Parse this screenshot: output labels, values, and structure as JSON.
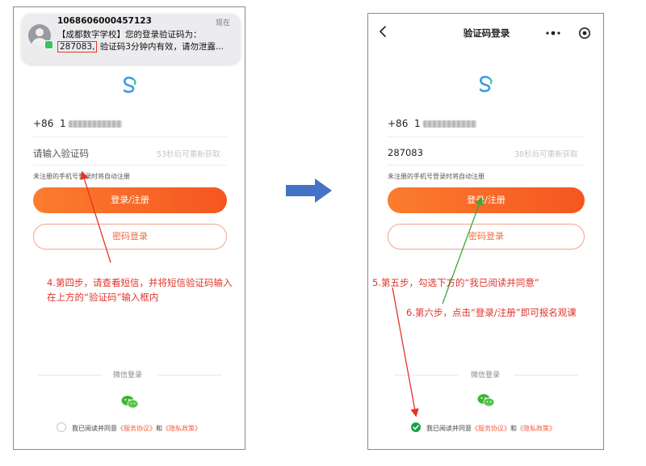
{
  "left": {
    "notification": {
      "sender": "1068606000457123",
      "time": "现在",
      "line1": "【成都数字学校】您的登录验证码为：",
      "code": "287083,",
      "line2_rest": " 验证码3分钟内有效，请勿泄露..."
    },
    "phone": {
      "country_code": "+86",
      "number_prefix": "1"
    },
    "code_field": {
      "placeholder": "请输入验证码",
      "hint": "53秒后可重新获取"
    },
    "note": "未注册的手机号登录时将自动注册",
    "login_button": "登录/注册",
    "password_button": "密码登录",
    "annotation": [
      "4.第四步，请查看短信，并将短信验证码输入",
      "在上方的“验证码”输入框内"
    ],
    "wechat_label": "微信登录",
    "agree": {
      "prefix": "我已阅读并同意",
      "terms": "《服务协议》",
      "and": "和",
      "privacy": "《隐私政策》"
    }
  },
  "right": {
    "title": "验证码登录",
    "phone": {
      "country_code": "+86",
      "number_prefix": "1"
    },
    "code_field": {
      "value": "287083",
      "hint": "38秒后可重新获取"
    },
    "note": "未注册的手机号登录时将自动注册",
    "login_button": "登录/注册",
    "password_button": "密码登录",
    "annotation_step5": "5.第五步，勾选下方的“我已阅读并同意”",
    "annotation_step6": "6.第六步，点击“登录/注册”即可报名观课",
    "wechat_label": "微信登录",
    "agree": {
      "prefix": "我已阅读并同意",
      "terms": "《服务协议》",
      "and": "和",
      "privacy": "《隐私政策》"
    }
  },
  "colors": {
    "accent": "#f55621",
    "annotation_red": "#e2332b",
    "annotation_green": "#3aa83a",
    "arrow_blue": "#4472c4",
    "checked_green": "#18a34a"
  }
}
